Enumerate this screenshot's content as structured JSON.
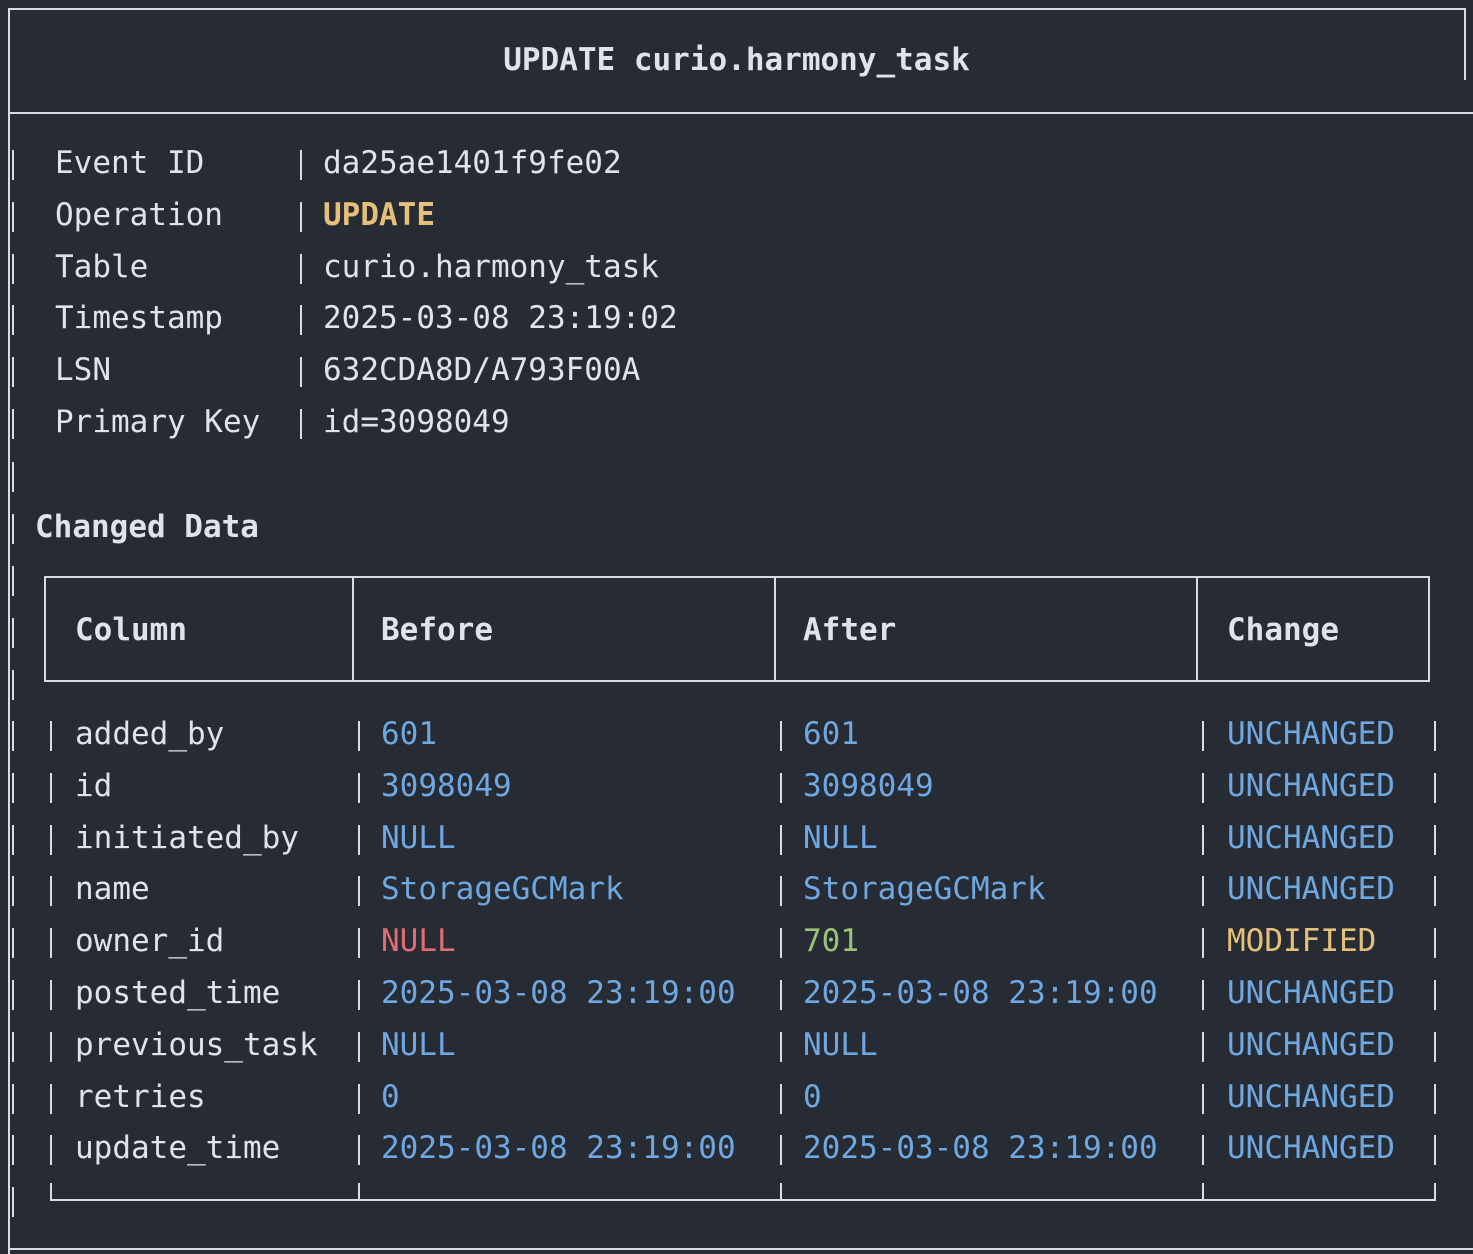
{
  "title": "UPDATE curio.harmony_task",
  "meta": [
    {
      "label": "Event ID",
      "value": "da25ae1401f9fe02"
    },
    {
      "label": "Operation",
      "value": "UPDATE"
    },
    {
      "label": "Table",
      "value": "curio.harmony_task"
    },
    {
      "label": "Timestamp",
      "value": "2025-03-08 23:19:02"
    },
    {
      "label": "LSN",
      "value": "632CDA8D/A793F00A"
    },
    {
      "label": "Primary Key",
      "value": "id=3098049"
    }
  ],
  "section_title": "Changed Data",
  "table": {
    "headers": [
      "Column",
      "Before",
      "After",
      "Change"
    ],
    "rows": [
      {
        "column": "added_by",
        "before": "601",
        "after": "601",
        "change": "UNCHANGED"
      },
      {
        "column": "id",
        "before": "3098049",
        "after": "3098049",
        "change": "UNCHANGED"
      },
      {
        "column": "initiated_by",
        "before": "NULL",
        "after": "NULL",
        "change": "UNCHANGED"
      },
      {
        "column": "name",
        "before": "StorageGCMark",
        "after": "StorageGCMark",
        "change": "UNCHANGED"
      },
      {
        "column": "owner_id",
        "before": "NULL",
        "after": "701",
        "change": "MODIFIED"
      },
      {
        "column": "posted_time",
        "before": "2025-03-08 23:19:00",
        "after": "2025-03-08 23:19:00",
        "change": "UNCHANGED"
      },
      {
        "column": "previous_task",
        "before": "NULL",
        "after": "NULL",
        "change": "UNCHANGED"
      },
      {
        "column": "retries",
        "before": "0",
        "after": "0",
        "change": "UNCHANGED"
      },
      {
        "column": "update_time",
        "before": "2025-03-08 23:19:00",
        "after": "2025-03-08 23:19:00",
        "change": "UNCHANGED"
      }
    ]
  },
  "colors": {
    "background": "#272b33",
    "text": "#dfe3ea",
    "value_blue": "#6fa7e0",
    "null_red": "#e06c75",
    "new_green": "#98c379",
    "highlight_yellow": "#e5c07b"
  }
}
